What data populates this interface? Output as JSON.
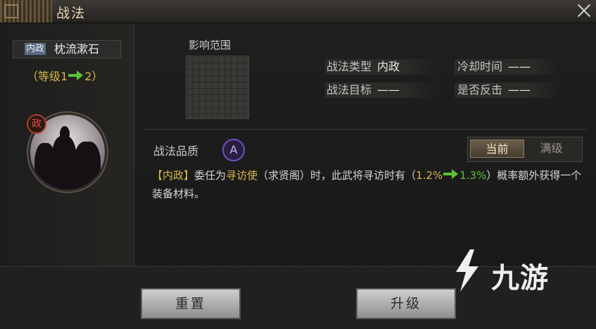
{
  "window": {
    "title": "战法"
  },
  "skill": {
    "type_tag": "内政",
    "name": "枕流漱石",
    "level": {
      "prefix": "（等级",
      "current": "1",
      "next": "2",
      "suffix": "）"
    },
    "portrait_badge": "政"
  },
  "range": {
    "label": "影响范围"
  },
  "stats": [
    {
      "key": "战法类型",
      "value": "内政"
    },
    {
      "key": "冷却时间",
      "value": "——"
    },
    {
      "key": "战法目标",
      "value": "——"
    },
    {
      "key": "是否反击",
      "value": "——"
    }
  ],
  "quality": {
    "label": "战法品质",
    "grade": "A"
  },
  "view_toggle": {
    "current": "当前",
    "max": "满级",
    "selected": "当前"
  },
  "description": {
    "tag": "【内政】",
    "p1": "委任为",
    "highlight": "寻访使",
    "p2": "（求贤阁）时，此武将寻访时有（",
    "rate_current": "1.2%",
    "rate_next": "1.3%",
    "p3": "）概率额外获得一个装备材料。"
  },
  "buttons": {
    "reset": "重置",
    "upgrade": "升级"
  },
  "watermark": {
    "text": "九游"
  },
  "colors": {
    "accent_gold": "#d7b64a",
    "upgrade_green": "#5bc236",
    "quality_purple": "#6b54c2",
    "tag_blue": "#5a6a80",
    "badge_red": "#b13a2a"
  }
}
